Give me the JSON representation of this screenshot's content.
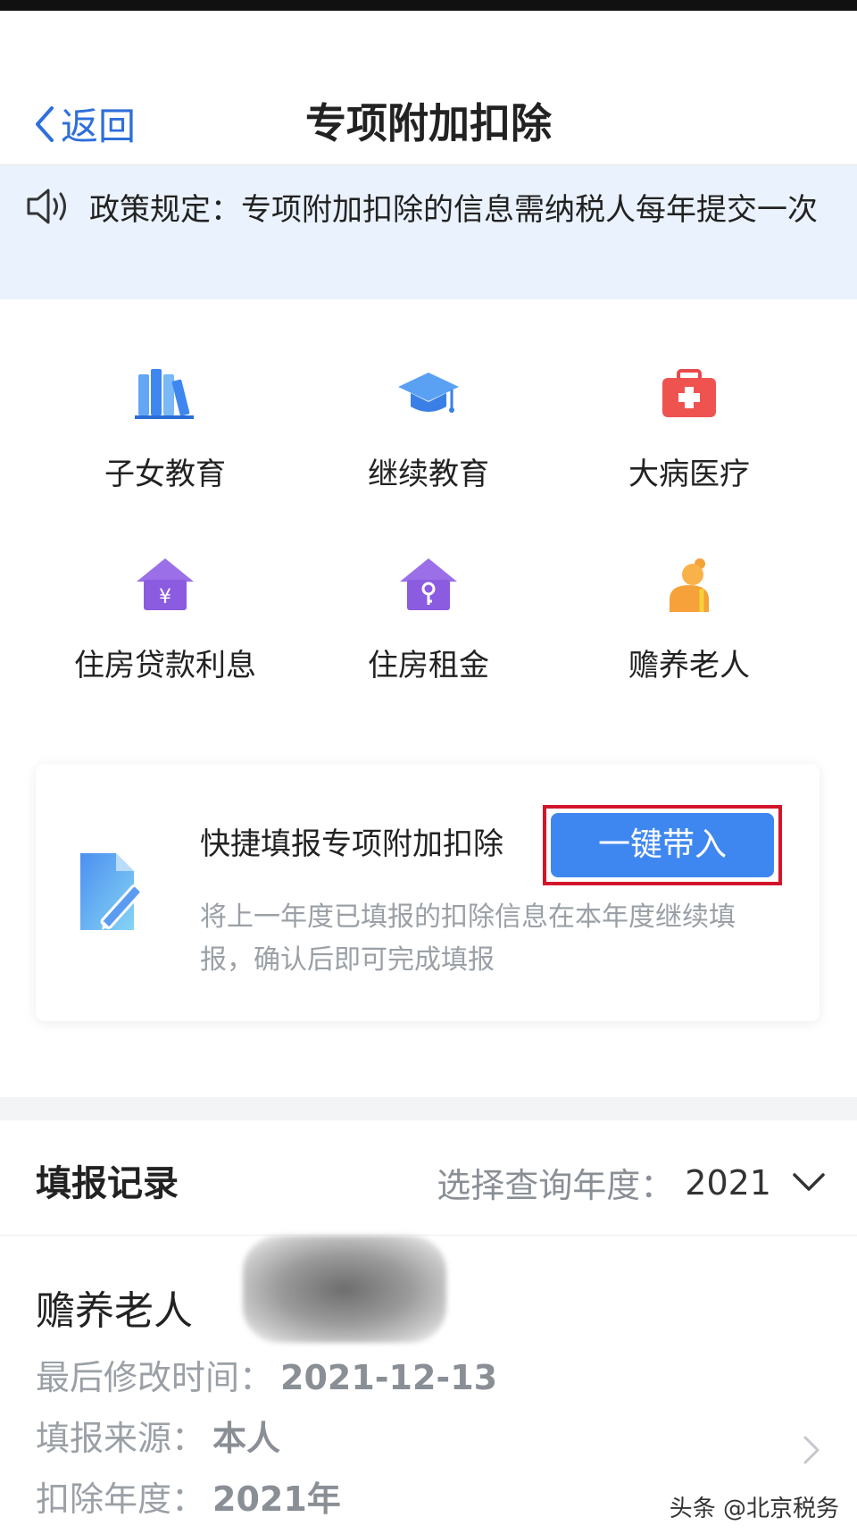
{
  "header": {
    "back_label": "返回",
    "title": "专项附加扣除"
  },
  "policy": {
    "text": "政策规定：专项附加扣除的信息需纳税人每年提交一次"
  },
  "categories": [
    {
      "label": "子女教育",
      "icon": "books-icon"
    },
    {
      "label": "继续教育",
      "icon": "graduation-cap-icon"
    },
    {
      "label": "大病医疗",
      "icon": "medical-kit-icon"
    },
    {
      "label": "住房贷款利息",
      "icon": "house-yuan-icon"
    },
    {
      "label": "住房租金",
      "icon": "house-key-icon"
    },
    {
      "label": "赡养老人",
      "icon": "elderly-person-icon"
    }
  ],
  "quick_fill": {
    "title": "快捷填报专项附加扣除",
    "button_label": "一键带入",
    "description": "将上一年度已填报的扣除信息在本年度继续填报，确认后即可完成填报",
    "highlight_color": "#d3152b"
  },
  "records": {
    "title": "填报记录",
    "year_label": "选择查询年度：",
    "year_value": "2021",
    "items": [
      {
        "name": "赡养老人",
        "modified_label": "最后修改时间：",
        "modified_value": "2021-12-13",
        "source_label": "填报来源：",
        "source_value": "本人",
        "year_label": "扣除年度：",
        "year_value": "2021年"
      }
    ]
  },
  "watermark": "头条 @北京税务",
  "colors": {
    "accent": "#2f6fdc",
    "button": "#3f87f0",
    "policy_bg": "#eaf2fd"
  }
}
